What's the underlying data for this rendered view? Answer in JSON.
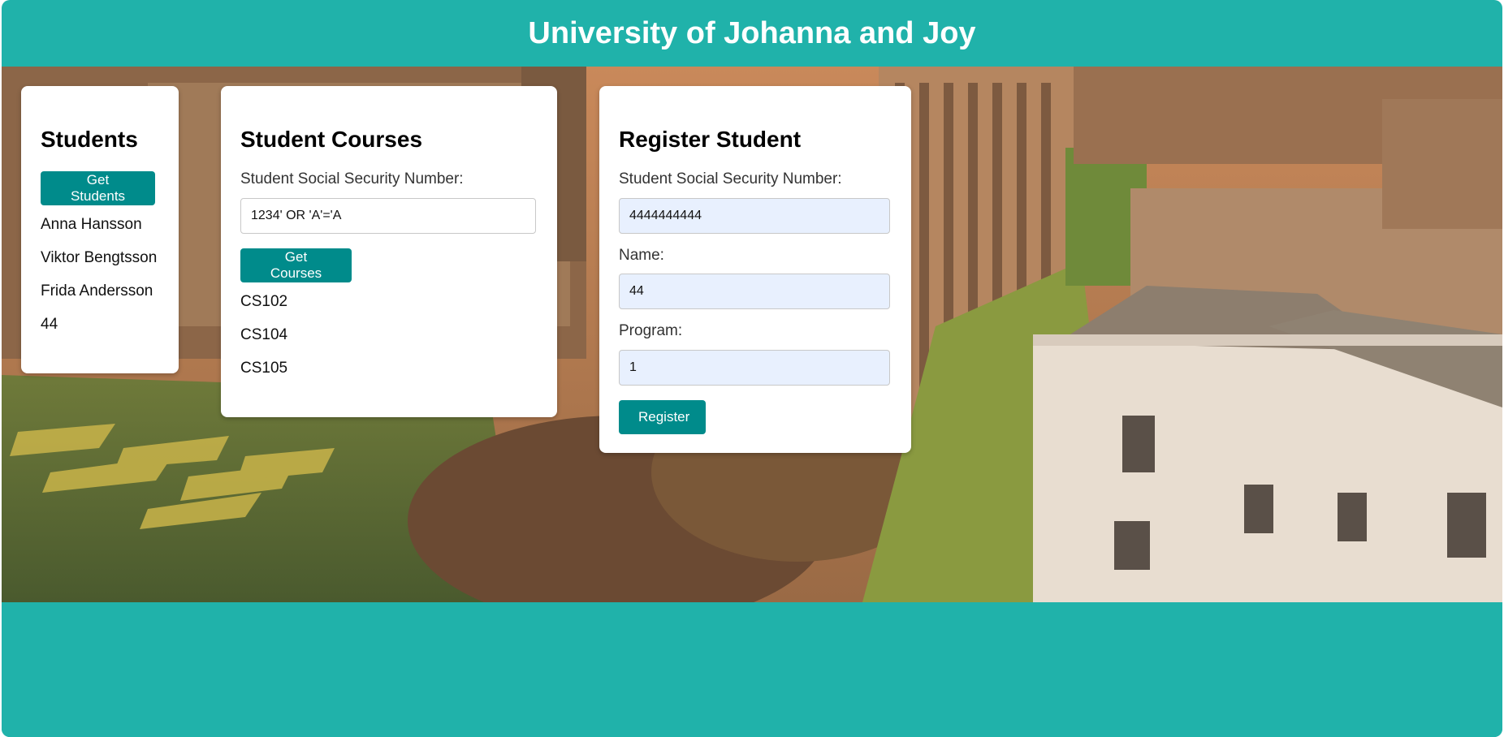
{
  "header": {
    "title": "University of Johanna and Joy"
  },
  "students": {
    "title": "Students",
    "button_label": "Get Students",
    "items": [
      "Anna Hansson",
      "Viktor Bengtsson",
      "Frida Andersson",
      "44"
    ]
  },
  "courses": {
    "title": "Student Courses",
    "ssn_label": "Student Social Security Number:",
    "ssn_value": "1234' OR 'A'='A",
    "button_label": "Get Courses",
    "items": [
      "CS102",
      "CS104",
      "CS105"
    ]
  },
  "register": {
    "title": "Register Student",
    "ssn_label": "Student Social Security Number:",
    "ssn_value": "4444444444",
    "name_label": "Name:",
    "name_value": "44",
    "program_label": "Program:",
    "program_value": "1",
    "button_label": "Register"
  },
  "colors": {
    "primary": "#20b2aa",
    "button": "#008b8b"
  }
}
